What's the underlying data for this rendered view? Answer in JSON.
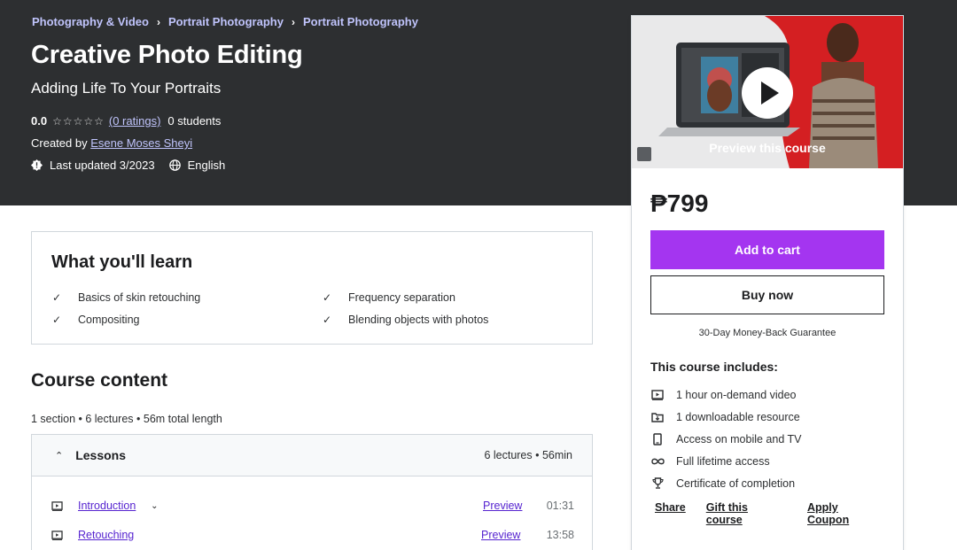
{
  "breadcrumbs": [
    "Photography & Video",
    "Portrait Photography",
    "Portrait Photography"
  ],
  "course": {
    "title": "Creative Photo Editing",
    "subtitle": "Adding Life To Your Portraits",
    "rating": "0.0",
    "stars": "☆☆☆☆☆",
    "ratings_link": "(0 ratings)",
    "students": "0 students",
    "created_by_label": "Created by",
    "instructor": "Esene Moses Sheyi",
    "last_updated": "Last updated 3/2023",
    "language": "English"
  },
  "sidebar": {
    "preview_caption": "Preview this course",
    "price": "₱799",
    "add_to_cart": "Add to cart",
    "buy_now": "Buy now",
    "guarantee": "30-Day Money-Back Guarantee",
    "includes_title": "This course includes:",
    "includes": [
      {
        "icon": "video-icon",
        "label": "1 hour on-demand video"
      },
      {
        "icon": "download-file-icon",
        "label": "1 downloadable resource"
      },
      {
        "icon": "mobile-icon",
        "label": "Access on mobile and TV"
      },
      {
        "icon": "infinity-icon",
        "label": "Full lifetime access"
      },
      {
        "icon": "trophy-icon",
        "label": "Certificate of completion"
      }
    ],
    "links": [
      "Share",
      "Gift this course",
      "Apply Coupon"
    ]
  },
  "learn": {
    "title": "What you'll learn",
    "items": [
      "Basics of skin retouching",
      "Frequency separation",
      "Compositing",
      "Blending objects with photos"
    ]
  },
  "content": {
    "title": "Course content",
    "meta": "1 section • 6 lectures • 56m total length",
    "section": {
      "name": "Lessons",
      "info": "6 lectures • 56min"
    },
    "lectures": [
      {
        "name": "Introduction",
        "preview": "Preview",
        "duration": "01:31"
      },
      {
        "name": "Retouching",
        "preview": "Preview",
        "duration": "13:58"
      }
    ]
  },
  "colors": {
    "accent": "#a435f0",
    "hero_bg": "#2d2f31",
    "link": "#5624d0",
    "breadcrumb": "#c0c4fc"
  }
}
